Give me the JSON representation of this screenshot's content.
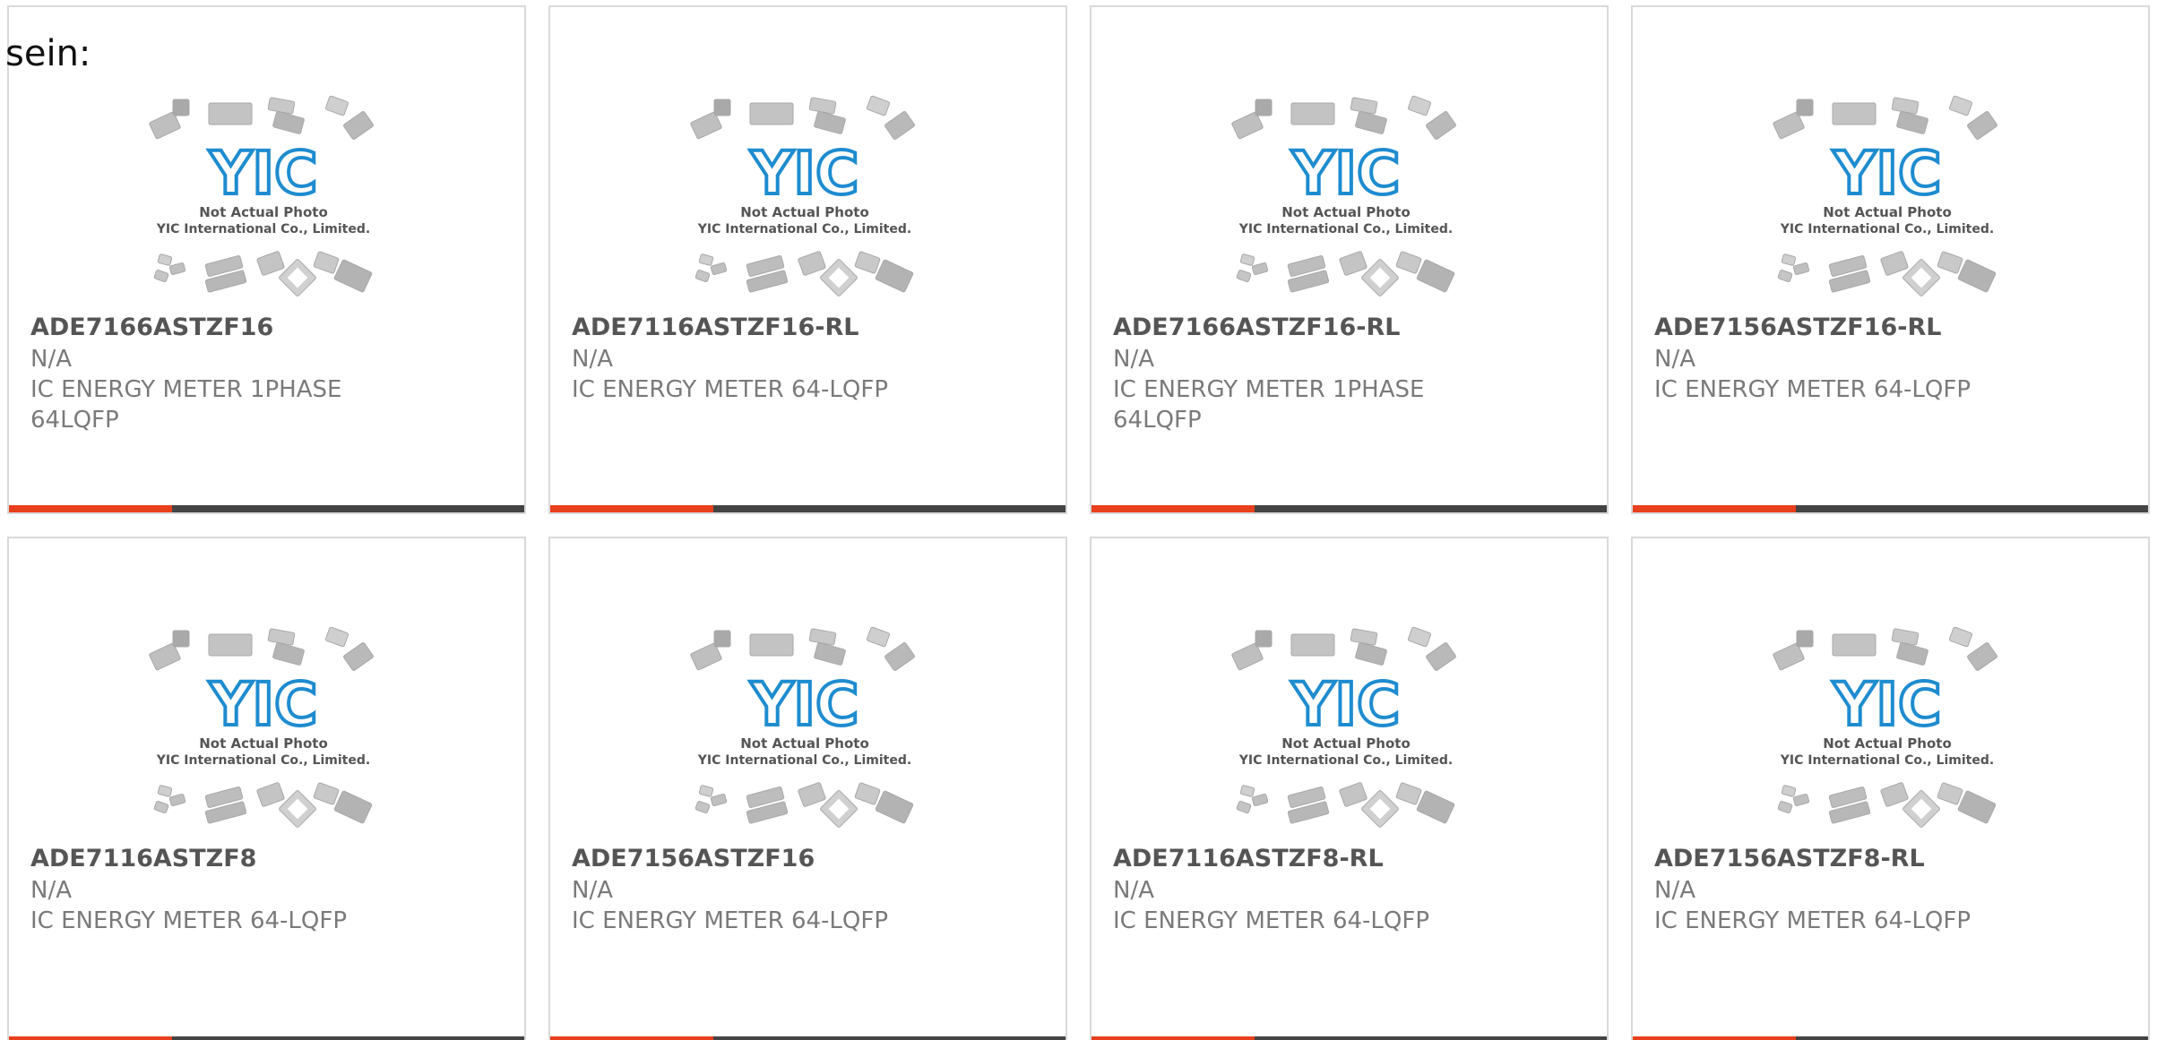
{
  "leading_text": "sein:",
  "colors": {
    "accent": "#e8401c",
    "bar": "#444444",
    "logo_blue": "#1e8ccf"
  },
  "placeholder": {
    "line1": "Not Actual Photo",
    "line2": "YIC International Co., Limited.",
    "logo_text": "YIC",
    "icon": "yic-placeholder-image"
  },
  "products": [
    {
      "part_number": "ADE7166ASTZF16",
      "manufacturer": "N/A",
      "description": "IC ENERGY METER 1PHASE 64LQFP"
    },
    {
      "part_number": "ADE7116ASTZF16-RL",
      "manufacturer": "N/A",
      "description": "IC ENERGY METER 64-LQFP"
    },
    {
      "part_number": "ADE7166ASTZF16-RL",
      "manufacturer": "N/A",
      "description": "IC ENERGY METER 1PHASE 64LQFP"
    },
    {
      "part_number": "ADE7156ASTZF16-RL",
      "manufacturer": "N/A",
      "description": "IC ENERGY METER 64-LQFP"
    },
    {
      "part_number": "ADE7116ASTZF8",
      "manufacturer": "N/A",
      "description": "IC ENERGY METER 64-LQFP"
    },
    {
      "part_number": "ADE7156ASTZF16",
      "manufacturer": "N/A",
      "description": "IC ENERGY METER 64-LQFP"
    },
    {
      "part_number": "ADE7116ASTZF8-RL",
      "manufacturer": "N/A",
      "description": "IC ENERGY METER 64-LQFP"
    },
    {
      "part_number": "ADE7156ASTZF8-RL",
      "manufacturer": "N/A",
      "description": "IC ENERGY METER 64-LQFP"
    }
  ]
}
